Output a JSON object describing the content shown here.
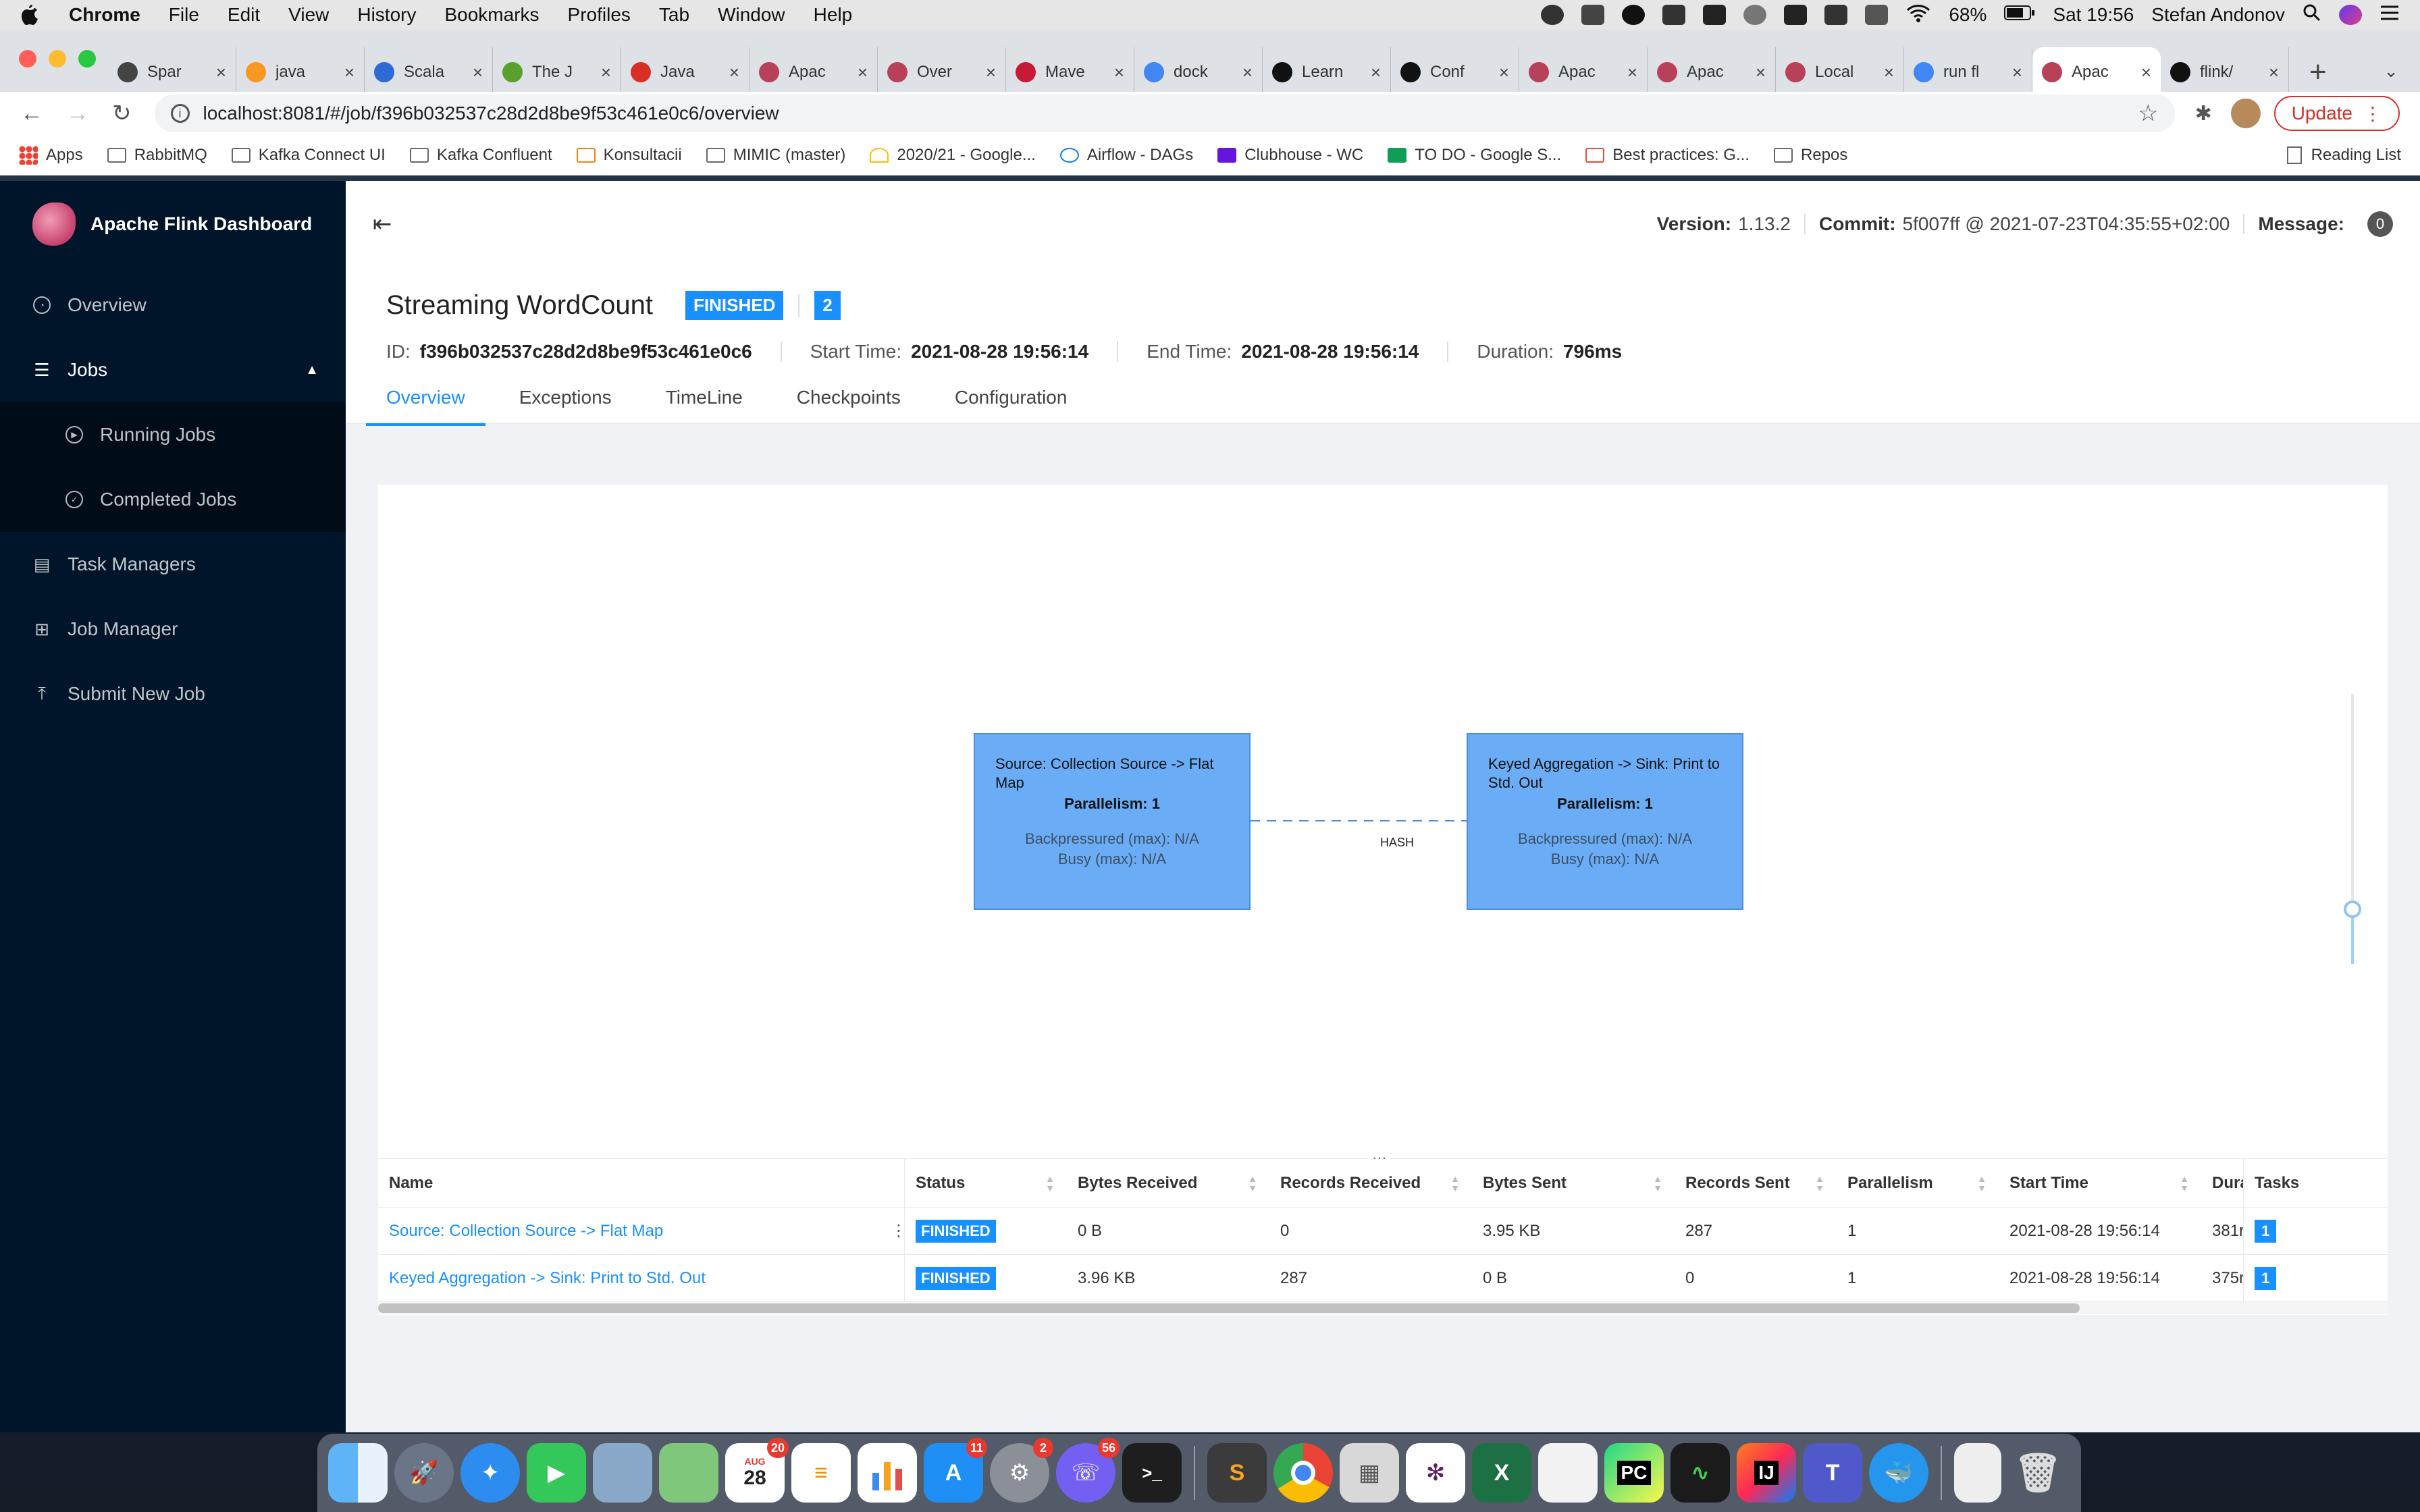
{
  "menubar": {
    "app": "Chrome",
    "items": [
      "File",
      "Edit",
      "View",
      "History",
      "Bookmarks",
      "Profiles",
      "Tab",
      "Window",
      "Help"
    ],
    "battery": "68%",
    "clock": "Sat 19:56",
    "user": "Stefan Andonov"
  },
  "tabs": [
    {
      "title": "Spar",
      "active": false
    },
    {
      "title": "java",
      "active": false
    },
    {
      "title": "Scala",
      "active": false
    },
    {
      "title": "The J",
      "active": false
    },
    {
      "title": "Java",
      "active": false
    },
    {
      "title": "Apac",
      "active": false
    },
    {
      "title": "Over",
      "active": false
    },
    {
      "title": "Mave",
      "active": false
    },
    {
      "title": "dock",
      "active": false
    },
    {
      "title": "Learn",
      "active": false
    },
    {
      "title": "Conf",
      "active": false
    },
    {
      "title": "Apac",
      "active": false
    },
    {
      "title": "Apac",
      "active": false
    },
    {
      "title": "Local",
      "active": false
    },
    {
      "title": "run fl",
      "active": false
    },
    {
      "title": "Apac",
      "active": true
    },
    {
      "title": "flink/",
      "active": false
    }
  ],
  "address_bar": {
    "url": "localhost:8081/#/job/f396b032537c28d2d8be9f53c461e0c6/overview",
    "update_label": "Update"
  },
  "bookmarks": {
    "items": [
      "Apps",
      "RabbitMQ",
      "Kafka Connect UI",
      "Kafka Confluent",
      "Konsultacii",
      "MIMIC (master)",
      "2020/21 - Google...",
      "Airflow - DAGs",
      "Clubhouse - WC",
      "TO DO - Google S...",
      "Best practices: G...",
      "Repos"
    ],
    "reading_list": "Reading List"
  },
  "sidebar": {
    "title": "Apache Flink Dashboard",
    "items": [
      {
        "label": "Overview"
      },
      {
        "label": "Jobs"
      },
      {
        "label": "Running Jobs"
      },
      {
        "label": "Completed Jobs"
      },
      {
        "label": "Task Managers"
      },
      {
        "label": "Job Manager"
      },
      {
        "label": "Submit New Job"
      }
    ]
  },
  "header": {
    "version_label": "Version:",
    "version": "1.13.2",
    "commit_label": "Commit:",
    "commit": "5f007ff @ 2021-07-23T04:35:55+02:00",
    "message_label": "Message:",
    "message_count": "0"
  },
  "job": {
    "name": "Streaming WordCount",
    "status": "FINISHED",
    "task_count": "2",
    "id_label": "ID:",
    "id": "f396b032537c28d2d8be9f53c461e0c6",
    "start_label": "Start Time:",
    "start": "2021-08-28 19:56:14",
    "end_label": "End Time:",
    "end": "2021-08-28 19:56:14",
    "duration_label": "Duration:",
    "duration": "796ms",
    "tabs": [
      "Overview",
      "Exceptions",
      "TimeLine",
      "Checkpoints",
      "Configuration"
    ]
  },
  "graph": {
    "nodes": [
      {
        "name": "Source: Collection Source -> Flat Map",
        "parallelism": "Parallelism: 1",
        "backpressure": "Backpressured (max): N/A",
        "busy": "Busy (max): N/A"
      },
      {
        "name": "Keyed Aggregation -> Sink: Print to Std. Out",
        "parallelism": "Parallelism: 1",
        "backpressure": "Backpressured (max): N/A",
        "busy": "Busy (max): N/A"
      }
    ],
    "edge_label": "HASH"
  },
  "table": {
    "headers": [
      "Name",
      "Status",
      "Bytes Received",
      "Records Received",
      "Bytes Sent",
      "Records Sent",
      "Parallelism",
      "Start Time",
      "Dura",
      "Tasks"
    ],
    "rows": [
      {
        "name": "Source: Collection Source -> Flat Map",
        "status": "FINISHED",
        "bytes_received": "0 B",
        "records_received": "0",
        "bytes_sent": "3.95 KB",
        "records_sent": "287",
        "parallelism": "1",
        "start_time": "2021-08-28 19:56:14",
        "duration": "381r",
        "tasks": "1"
      },
      {
        "name": "Keyed Aggregation -> Sink: Print to Std. Out",
        "status": "FINISHED",
        "bytes_received": "3.96 KB",
        "records_received": "287",
        "bytes_sent": "0 B",
        "records_sent": "0",
        "parallelism": "1",
        "start_time": "2021-08-28 19:56:14",
        "duration": "375r",
        "tasks": "1"
      }
    ]
  },
  "dock": {
    "badges": {
      "calendar_date": "28",
      "calendar_month": "AUG",
      "calendar_badge": "20",
      "appstore_badge": "11",
      "prefs_badge": "2",
      "viber_badge": "56"
    },
    "labels": {
      "pycharm": "PC",
      "intellij": "IJ",
      "excel": "X"
    }
  }
}
